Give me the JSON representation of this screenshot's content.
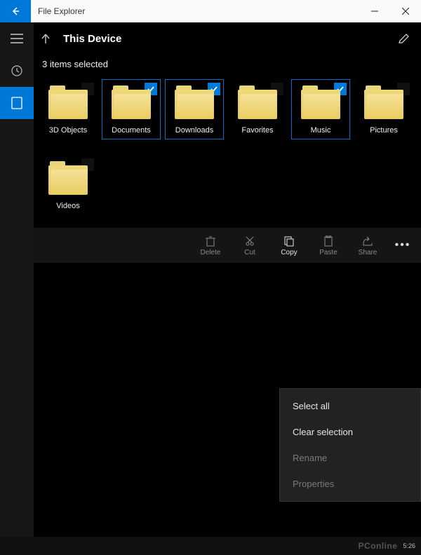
{
  "title": "File Explorer",
  "path": "This Device",
  "status": "3 items selected",
  "items": [
    {
      "label": "3D Objects",
      "selected": false
    },
    {
      "label": "Documents",
      "selected": true
    },
    {
      "label": "Downloads",
      "selected": true
    },
    {
      "label": "Favorites",
      "selected": false
    },
    {
      "label": "Music",
      "selected": true
    },
    {
      "label": "Pictures",
      "selected": false
    },
    {
      "label": "Videos",
      "selected": false
    }
  ],
  "menu": [
    {
      "label": "Select all",
      "enabled": true
    },
    {
      "label": "Clear selection",
      "enabled": true
    },
    {
      "label": "Rename",
      "enabled": false
    },
    {
      "label": "Properties",
      "enabled": false
    }
  ],
  "commands": {
    "delete": "Delete",
    "cut": "Cut",
    "copy": "Copy",
    "paste": "Paste",
    "share": "Share"
  },
  "taskbar": {
    "watermark": "PConline",
    "clock": "5:26"
  }
}
